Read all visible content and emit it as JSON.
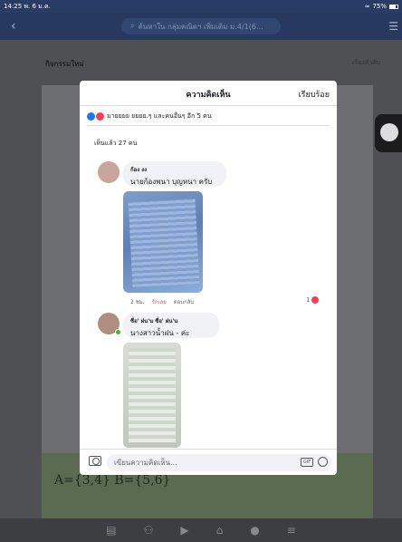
{
  "status_bar": {
    "time": "14:25",
    "date": "พ. 6 ม.ค.",
    "battery": "75%"
  },
  "search": {
    "placeholder": "ค้นหาใน กลุ่มคณิตฯ เพิ่มเติม ม.4/1(6..."
  },
  "feed": {
    "section_title": "กิจกรรมใหม่",
    "sort_label": "เรียงลำดับ",
    "board_text": "A={3,4}  B={5,6}"
  },
  "modal": {
    "title": "ความคิดเห็น",
    "done_label": "เรียบร้อย",
    "reactions_text": "มายยยย ยยยย.ๆ และคนอื่นๆ อีก 5 คน",
    "seen_text": "เห็นแล้ว 27 คน",
    "comments": [
      {
        "name": "ก้อง งง",
        "text": "นายก้องพนา บุญหนา ครับ",
        "time": "2 ชม.",
        "like_label": "รักเลย",
        "reply_label": "ตอบกลับ",
        "reaction_count": "1"
      },
      {
        "name": "ซื่อ' ฝน'น ซื่อ' ฝน'น",
        "text": "นางสาวน้ำฝน - ค่ะ"
      }
    ],
    "input_placeholder": "เขียนความคิดเห็น...",
    "gif_label": "GIF"
  },
  "colors": {
    "accent": "#1877f2",
    "heart": "#f33e58",
    "topbar": "#27395e"
  }
}
